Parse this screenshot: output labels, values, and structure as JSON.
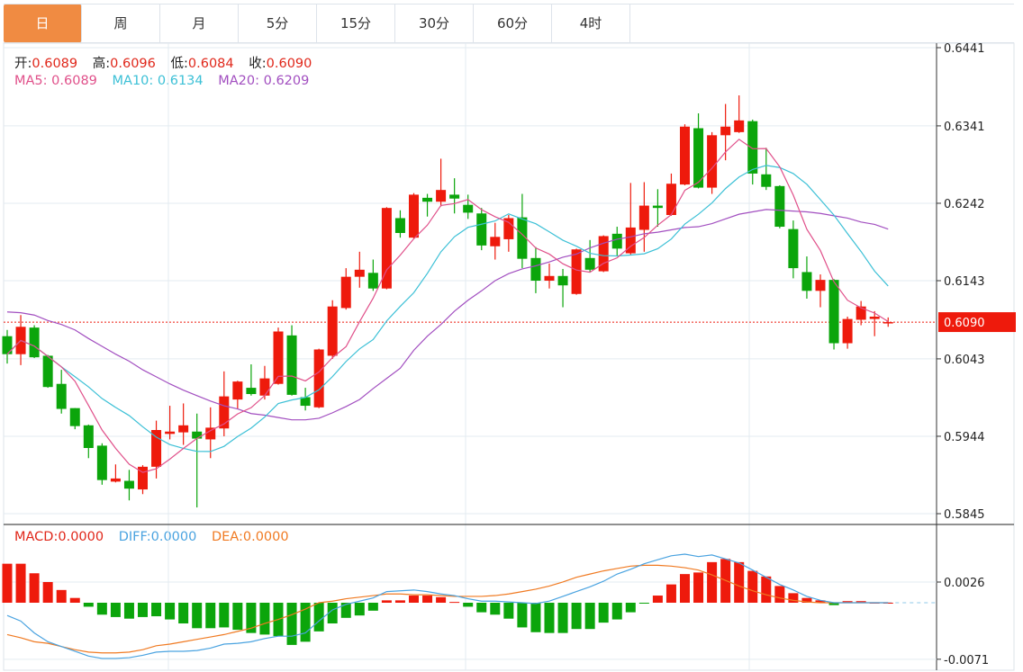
{
  "tabs": [
    {
      "label": "日",
      "active": true
    },
    {
      "label": "周",
      "active": false
    },
    {
      "label": "月",
      "active": false
    },
    {
      "label": "5分",
      "active": false
    },
    {
      "label": "15分",
      "active": false
    },
    {
      "label": "30分",
      "active": false
    },
    {
      "label": "60分",
      "active": false
    },
    {
      "label": "4时",
      "active": false
    }
  ],
  "ohlc_legend": {
    "open_label": "开:",
    "open": "0.6089",
    "high_label": "高:",
    "high": "0.6096",
    "low_label": "低:",
    "low": "0.6084",
    "close_label": "收:",
    "close": "0.6090"
  },
  "ma_legend": {
    "ma5_label": "MA5:",
    "ma5": "0.6089",
    "ma10_label": "MA10:",
    "ma10": "0.6134",
    "ma20_label": "MA20:",
    "ma20": "0.6209"
  },
  "macd_legend": {
    "macd_label": "MACD:",
    "macd": "0.0000",
    "diff_label": "DIFF:",
    "diff": "0.0000",
    "dea_label": "DEA:",
    "dea": "0.0000"
  },
  "colors": {
    "up": "#ee1a0c",
    "down": "#0ba50b",
    "ma5": "#e0508a",
    "ma10": "#3cc0d6",
    "ma20": "#a24fc0",
    "diff": "#4aa3e0",
    "dea": "#f07a22",
    "tab_active": "#f08b42",
    "price_tag": "#ee1a0c"
  },
  "chart_data": {
    "type": "candlestick",
    "price_axis": {
      "ticks": [
        "0.6441",
        "0.6341",
        "0.6242",
        "0.6143",
        "0.6043",
        "0.5944",
        "0.5845"
      ],
      "range": [
        0.5845,
        0.6441
      ]
    },
    "current_price": "0.6090",
    "candles": [
      [
        0.6072,
        0.608,
        0.6037,
        0.6049
      ],
      [
        0.6049,
        0.6099,
        0.6035,
        0.6084
      ],
      [
        0.6083,
        0.6086,
        0.6044,
        0.6045
      ],
      [
        0.6047,
        0.6048,
        0.6006,
        0.6007
      ],
      [
        0.6011,
        0.6029,
        0.5973,
        0.5979
      ],
      [
        0.598,
        0.598,
        0.5953,
        0.5957
      ],
      [
        0.5958,
        0.5959,
        0.5916,
        0.5929
      ],
      [
        0.5932,
        0.5935,
        0.5882,
        0.5888
      ],
      [
        0.5886,
        0.5908,
        0.5885,
        0.589
      ],
      [
        0.5887,
        0.5901,
        0.5862,
        0.5877
      ],
      [
        0.5876,
        0.5907,
        0.587,
        0.5905
      ],
      [
        0.5905,
        0.5964,
        0.589,
        0.5952
      ],
      [
        0.5947,
        0.5983,
        0.594,
        0.595
      ],
      [
        0.5949,
        0.5986,
        0.5933,
        0.5958
      ],
      [
        0.595,
        0.5973,
        0.5853,
        0.5941
      ],
      [
        0.594,
        0.5981,
        0.5916,
        0.5955
      ],
      [
        0.5954,
        0.6027,
        0.5944,
        0.5995
      ],
      [
        0.5991,
        0.6015,
        0.5979,
        0.6014
      ],
      [
        0.6006,
        0.6036,
        0.5996,
        0.5998
      ],
      [
        0.5996,
        0.6034,
        0.5991,
        0.6018
      ],
      [
        0.6011,
        0.6083,
        0.601,
        0.6078
      ],
      [
        0.6073,
        0.6086,
        0.5996,
        0.5997
      ],
      [
        0.5994,
        0.6006,
        0.5977,
        0.5983
      ],
      [
        0.5981,
        0.6056,
        0.598,
        0.6055
      ],
      [
        0.6047,
        0.6118,
        0.6043,
        0.611
      ],
      [
        0.6108,
        0.6159,
        0.6106,
        0.6148
      ],
      [
        0.6148,
        0.618,
        0.6134,
        0.6157
      ],
      [
        0.6153,
        0.617,
        0.613,
        0.6133
      ],
      [
        0.6133,
        0.6237,
        0.6132,
        0.6236
      ],
      [
        0.6223,
        0.6233,
        0.6198,
        0.6204
      ],
      [
        0.6198,
        0.6255,
        0.6197,
        0.6253
      ],
      [
        0.6249,
        0.6254,
        0.6225,
        0.6244
      ],
      [
        0.6244,
        0.6299,
        0.6238,
        0.6259
      ],
      [
        0.6253,
        0.6274,
        0.6229,
        0.6248
      ],
      [
        0.624,
        0.6253,
        0.6222,
        0.623
      ],
      [
        0.6229,
        0.6236,
        0.6182,
        0.6188
      ],
      [
        0.6187,
        0.6217,
        0.617,
        0.6199
      ],
      [
        0.6196,
        0.6227,
        0.618,
        0.6223
      ],
      [
        0.6224,
        0.6254,
        0.6159,
        0.6171
      ],
      [
        0.6172,
        0.6186,
        0.6127,
        0.6143
      ],
      [
        0.6143,
        0.6165,
        0.6133,
        0.6149
      ],
      [
        0.6149,
        0.6158,
        0.6109,
        0.6137
      ],
      [
        0.6126,
        0.6184,
        0.6125,
        0.6183
      ],
      [
        0.6172,
        0.6195,
        0.6154,
        0.6157
      ],
      [
        0.6155,
        0.6201,
        0.6154,
        0.62
      ],
      [
        0.6203,
        0.6212,
        0.6174,
        0.6184
      ],
      [
        0.6178,
        0.6268,
        0.6176,
        0.6211
      ],
      [
        0.6208,
        0.6269,
        0.618,
        0.6239
      ],
      [
        0.6239,
        0.626,
        0.6212,
        0.6236
      ],
      [
        0.6227,
        0.628,
        0.6226,
        0.6267
      ],
      [
        0.6266,
        0.6343,
        0.6265,
        0.634
      ],
      [
        0.6338,
        0.6357,
        0.6261,
        0.6262
      ],
      [
        0.6262,
        0.6333,
        0.6254,
        0.6329
      ],
      [
        0.6329,
        0.6369,
        0.6297,
        0.634
      ],
      [
        0.6333,
        0.638,
        0.6332,
        0.6348
      ],
      [
        0.6347,
        0.6349,
        0.6266,
        0.628
      ],
      [
        0.6279,
        0.6313,
        0.6259,
        0.6263
      ],
      [
        0.6264,
        0.6265,
        0.621,
        0.6212
      ],
      [
        0.6209,
        0.622,
        0.6146,
        0.6159
      ],
      [
        0.6154,
        0.6174,
        0.612,
        0.613
      ],
      [
        0.613,
        0.6151,
        0.6109,
        0.6144
      ],
      [
        0.6144,
        0.6145,
        0.6055,
        0.6063
      ],
      [
        0.6063,
        0.6097,
        0.6056,
        0.6094
      ],
      [
        0.6093,
        0.6117,
        0.6086,
        0.611
      ],
      [
        0.6094,
        0.6104,
        0.6072,
        0.6097
      ],
      [
        0.6089,
        0.6096,
        0.6084,
        0.609
      ]
    ],
    "ma20": [
      0.6103,
      0.6102,
      0.6099,
      0.6092,
      0.6087,
      0.608,
      0.6069,
      0.6059,
      0.6049,
      0.604,
      0.6029,
      0.602,
      0.6011,
      0.6003,
      0.5996,
      0.5989,
      0.5983,
      0.5979,
      0.5973,
      0.5971,
      0.5968,
      0.5965,
      0.5965,
      0.5967,
      0.5974,
      0.5982,
      0.5991,
      0.6005,
      0.6018,
      0.6031,
      0.6054,
      0.6072,
      0.6087,
      0.6104,
      0.6118,
      0.613,
      0.6143,
      0.6152,
      0.6158,
      0.6162,
      0.6167,
      0.6173,
      0.6177,
      0.6185,
      0.6191,
      0.6196,
      0.6199,
      0.6203,
      0.6205,
      0.6208,
      0.6211,
      0.6212,
      0.6216,
      0.6222,
      0.6228,
      0.6231,
      0.6234,
      0.6233,
      0.6232,
      0.6231,
      0.6229,
      0.6226,
      0.6223,
      0.6218,
      0.6215,
      0.6209
    ],
    "macd_axis": {
      "ticks": [
        "0.0026",
        "-0.0071"
      ]
    },
    "macd_hist": [
      0.0049,
      0.0049,
      0.0037,
      0.0026,
      0.0016,
      0.0006,
      -0.0005,
      -0.0015,
      -0.0018,
      -0.002,
      -0.0018,
      -0.0017,
      -0.0021,
      -0.0026,
      -0.0032,
      -0.0032,
      -0.0031,
      -0.0034,
      -0.0038,
      -0.004,
      -0.0042,
      -0.0053,
      -0.0049,
      -0.0036,
      -0.0026,
      -0.0019,
      -0.0016,
      -0.001,
      0.0003,
      0.0003,
      0.0009,
      0.0009,
      0.0007,
      0.0001,
      -0.0005,
      -0.0012,
      -0.0015,
      -0.002,
      -0.0031,
      -0.0037,
      -0.0038,
      -0.0038,
      -0.0033,
      -0.0033,
      -0.0025,
      -0.0021,
      -0.0012,
      -0.0001,
      0.0009,
      0.0023,
      0.0036,
      0.0038,
      0.0051,
      0.0055,
      0.0051,
      0.004,
      0.0033,
      0.0021,
      0.0012,
      0.0006,
      0.0003,
      -0.0003,
      0.0002,
      0.0002,
      0.0,
      0.0
    ],
    "diff": [
      -0.0016,
      -0.0023,
      -0.0038,
      -0.0049,
      -0.0055,
      -0.0061,
      -0.0067,
      -0.007,
      -0.007,
      -0.0069,
      -0.0066,
      -0.0062,
      -0.0061,
      -0.0061,
      -0.006,
      -0.0057,
      -0.0052,
      -0.0051,
      -0.0049,
      -0.0045,
      -0.0042,
      -0.0042,
      -0.0038,
      -0.0023,
      -0.0009,
      -0.0002,
      0.0002,
      0.0006,
      0.0014,
      0.0015,
      0.0016,
      0.0014,
      0.0011,
      0.0009,
      0.0005,
      0.0002,
      0.0002,
      0.0001,
      0.0,
      -0.0001,
      0.0002,
      0.0008,
      0.0014,
      0.002,
      0.0027,
      0.0036,
      0.0042,
      0.0049,
      0.0054,
      0.0059,
      0.0061,
      0.0058,
      0.006,
      0.0055,
      0.005,
      0.0041,
      0.0032,
      0.0023,
      0.0016,
      0.0008,
      0.0003,
      0.0,
      0.0,
      0.0,
      0.0,
      0.0
    ],
    "dea": [
      -0.004,
      -0.0044,
      -0.0049,
      -0.0051,
      -0.0055,
      -0.0059,
      -0.0062,
      -0.0063,
      -0.0063,
      -0.0062,
      -0.0059,
      -0.0054,
      -0.0052,
      -0.0049,
      -0.0046,
      -0.0043,
      -0.004,
      -0.0036,
      -0.0032,
      -0.0026,
      -0.0021,
      -0.0015,
      -0.0008,
      0.0,
      0.0002,
      0.0005,
      0.0007,
      0.0009,
      0.0011,
      0.0011,
      0.001,
      0.001,
      0.0009,
      0.0008,
      0.0008,
      0.0008,
      0.0009,
      0.0011,
      0.0014,
      0.0017,
      0.0021,
      0.0026,
      0.0032,
      0.0036,
      0.004,
      0.0043,
      0.0046,
      0.0047,
      0.0047,
      0.0046,
      0.0044,
      0.0041,
      0.0035,
      0.0028,
      0.0021,
      0.0015,
      0.001,
      0.0006,
      0.0003,
      0.0001,
      0.0,
      0.0,
      0.0,
      0.0,
      0.0,
      0.0
    ]
  }
}
